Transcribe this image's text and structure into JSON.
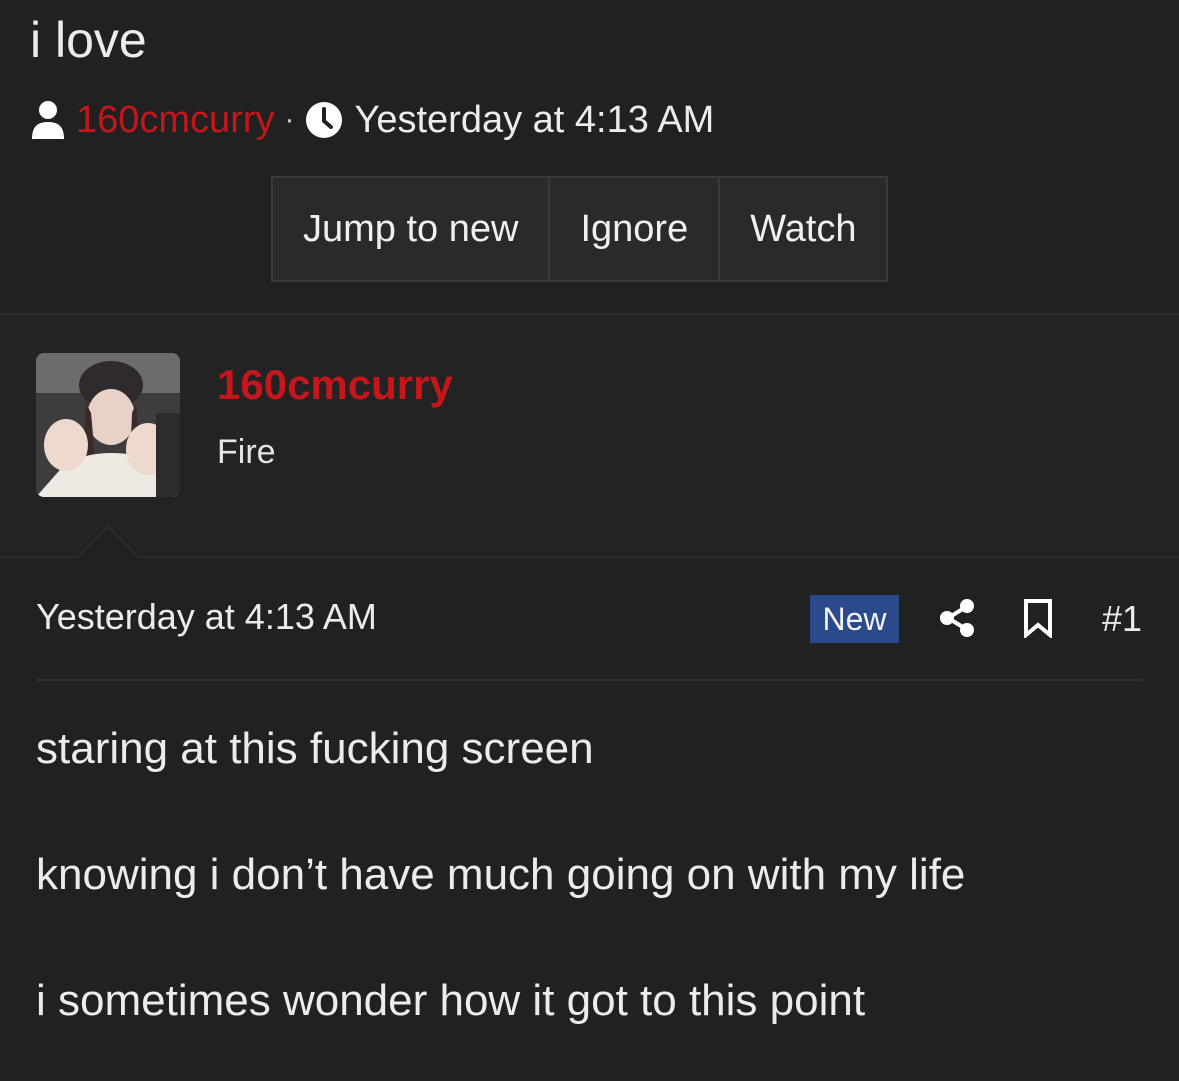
{
  "thread": {
    "title": "i love",
    "author": "160cmcurry",
    "separator": "·",
    "date": "Yesterday at 4:13 AM"
  },
  "actions": {
    "jump_to_new": "Jump to new",
    "ignore": "Ignore",
    "watch": "Watch"
  },
  "post": {
    "author": "160cmcurry",
    "user_title": "Fire",
    "date": "Yesterday at 4:13 AM",
    "badge": "New",
    "number": "#1",
    "lines": [
      "staring at this fucking screen",
      "knowing i don’t have much going on with my life",
      "i sometimes wonder how it got to this point"
    ]
  },
  "colors": {
    "background": "#212122",
    "author_red": "#c4161b",
    "badge_blue": "#2b4a8b"
  },
  "icons": [
    "user-icon",
    "clock-icon",
    "share-icon",
    "bookmark-icon"
  ]
}
